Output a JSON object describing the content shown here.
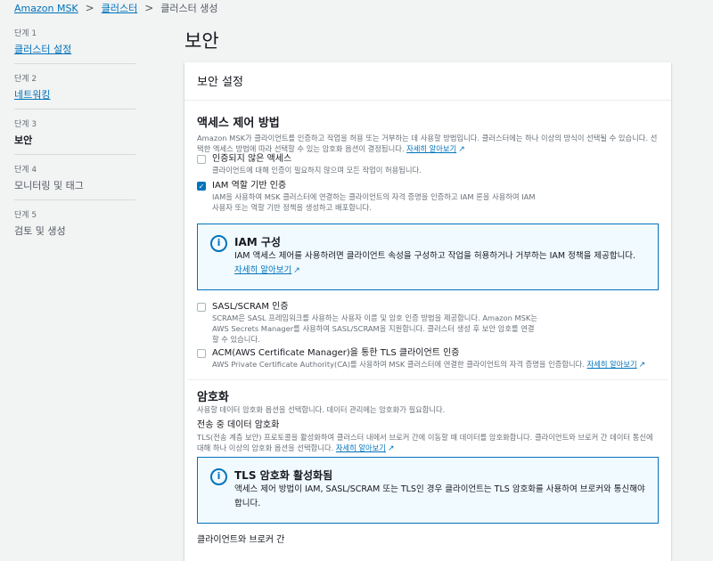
{
  "breadcrumb": [
    "Amazon MSK",
    "클러스터",
    "클러스터 생성"
  ],
  "steps": [
    {
      "num": "단계 1",
      "label": "클러스터 설정"
    },
    {
      "num": "단계 2",
      "label": "네트워킹"
    },
    {
      "num": "단계 3",
      "label": "보안"
    },
    {
      "num": "단계 4",
      "label": "모니터링 및 태그"
    },
    {
      "num": "단계 5",
      "label": "검토 및 생성"
    }
  ],
  "page_title": "보안",
  "card_title": "보안 설정",
  "access": {
    "title": "액세스 제어 방법",
    "desc": "Amazon MSK가 클라이언트를 인증하고 작업을 허용 또는 거부하는 데 사용할 방법입니다. 클러스터에는 하나 이상의 방식이 선택될 수 있습니다. 선택한 액세스 방법에 따라 선택할 수 있는 암호화 옵션이 결정됩니다.",
    "learn_more": "자세히 알아보기",
    "options": [
      {
        "label": "인증되지 않은 액세스",
        "desc": "클라이언트에 대해 인증이 필요하지 않으며 모든 작업이 허용됩니다.",
        "checked": false
      },
      {
        "label": "IAM 역할 기반 인증",
        "desc": "IAM을 사용하여 MSK 클러스터에 연결하는 클라이언트의 자격 증명을 인증하고 IAM 론을 사용하여 IAM 사용자 또는 역할 기반 정책을 생성하고 배포합니다.",
        "checked": true
      },
      {
        "label": "SASL/SCRAM 인증",
        "desc": "SCRAM은 SASL 프레임워크를 사용하는 사용자 이름 및 암호 인증 방법을 제공합니다. Amazon MSK는 AWS Secrets Manager를 사용하여 SASL/SCRAM을 지원합니다. 클러스터 생성 후 보안 암호를 연결할 수 있습니다.",
        "checked": false
      },
      {
        "label": "ACM(AWS Certificate Manager)을 통한 TLS 클라이언트 인증",
        "desc": "AWS Private Certificate Authority(CA)를 사용하여 MSK 클러스터에 연결한 클라이언트의 자격 증명을 인증합니다.",
        "checked": false
      }
    ],
    "iam_info": {
      "title": "IAM 구성",
      "text": "IAM 액세스 제어를 사용하려면 클라이언트 속성을 구성하고 작업을 허용하거나 거부하는 IAM 정책을 제공합니다."
    }
  },
  "encryption": {
    "title": "암호화",
    "desc": "사용할 데이터 암호화 옵션을 선택합니다. 데이터 관리에는 암호화가 필요합니다.",
    "transit_title": "전송 중 데이터 암호화",
    "transit_desc": "TLS(전송 계층 보안) 프로토콜을 활성화하여 클러스터 내에서 브로커 간에 이동할 때 데이터를 암호화합니다. 클라이언트와 브로커 간 데이터 통신에 대해 하나 이상의 암호화 옵션을 선택합니다.",
    "tls_info": {
      "title": "TLS 암호화 활성화됨",
      "text": "액세스 제어 방법이 IAM, SASL/SCRAM 또는 TLS인 경우 클라이언트는 TLS 암호화를 사용하여 브로커와 통신해야 합니다."
    },
    "client_broker": "클라이언트와 브로커 간"
  }
}
